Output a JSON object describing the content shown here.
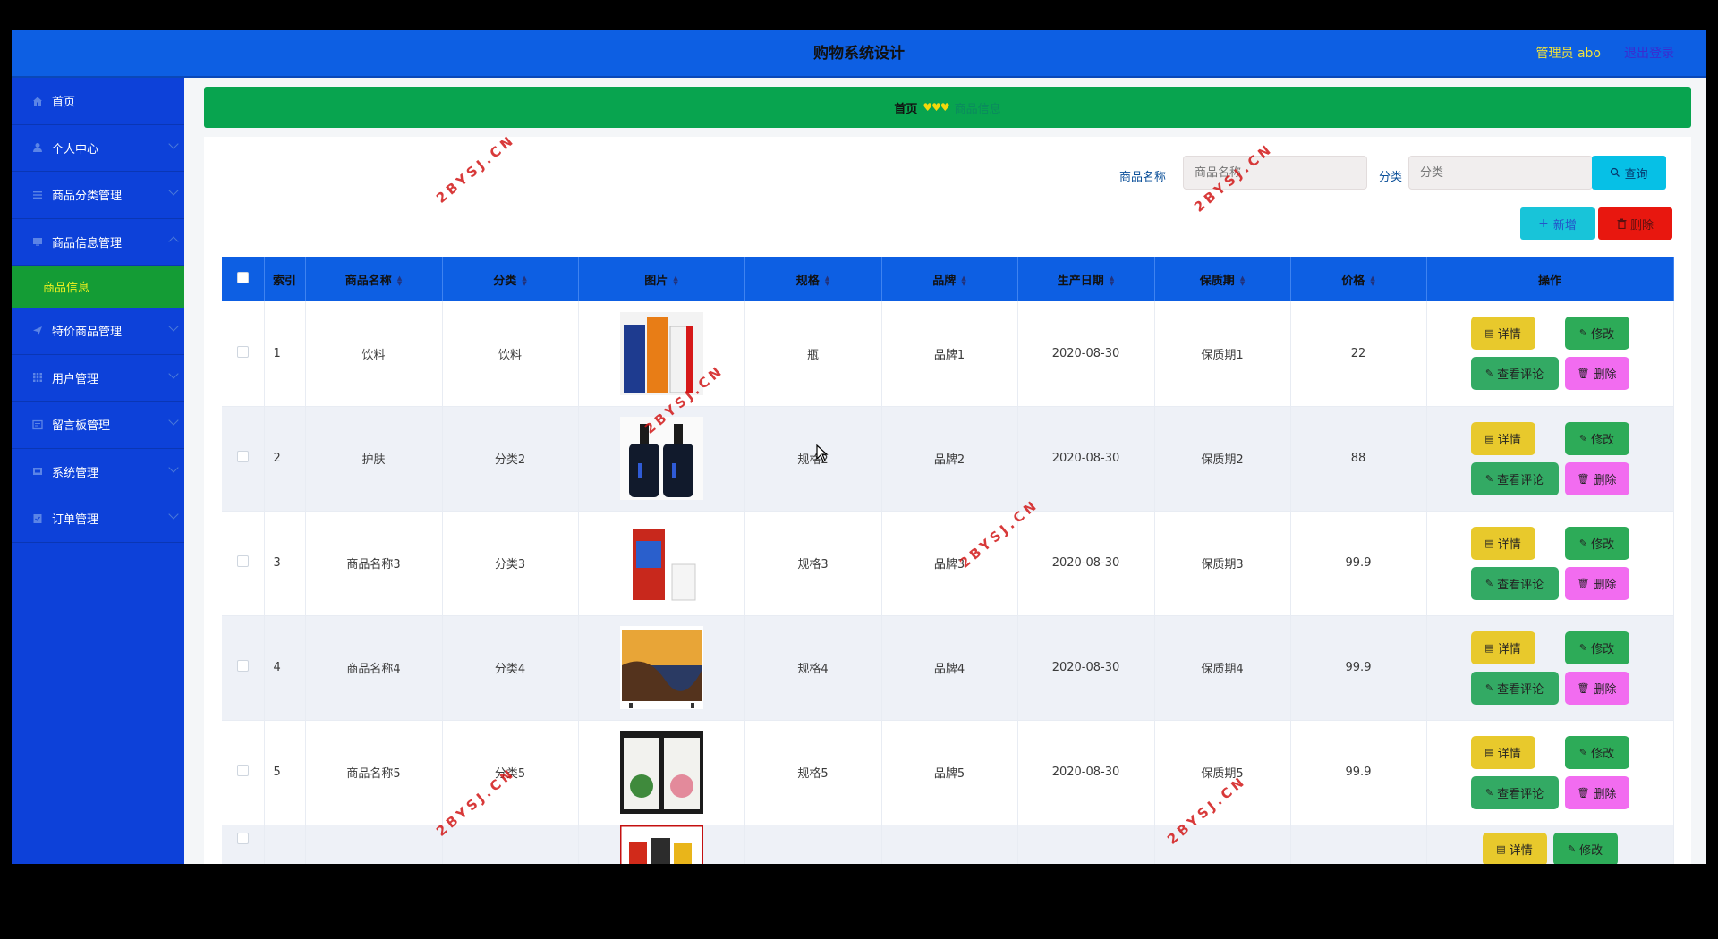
{
  "header": {
    "title": "购物系统设计",
    "admin": "管理员 abo",
    "logout": "退出登录"
  },
  "sidebar": {
    "items": [
      {
        "label": "首页",
        "icon": "home-icon"
      },
      {
        "label": "个人中心",
        "icon": "user-icon"
      },
      {
        "label": "商品分类管理",
        "icon": "list-icon"
      },
      {
        "label": "商品信息管理",
        "icon": "monitor-icon",
        "sub": "商品信息"
      },
      {
        "label": "特价商品管理",
        "icon": "send-icon"
      },
      {
        "label": "用户管理",
        "icon": "grid-icon"
      },
      {
        "label": "留言板管理",
        "icon": "message-icon"
      },
      {
        "label": "系统管理",
        "icon": "settings-icon"
      },
      {
        "label": "订单管理",
        "icon": "order-icon"
      }
    ]
  },
  "breadcrumb": {
    "home": "首页",
    "separator": "♥♥♥",
    "current": "商品信息"
  },
  "search": {
    "name_label": "商品名称",
    "name_placeholder": "商品名称",
    "category_label": "分类",
    "category_placeholder": "分类",
    "query_button": "查询"
  },
  "actions": {
    "add": "新增",
    "delete": "删除"
  },
  "table": {
    "headers": [
      "索引",
      "商品名称",
      "分类",
      "图片",
      "规格",
      "品牌",
      "生产日期",
      "保质期",
      "价格",
      "操作"
    ],
    "rows": [
      {
        "index": "1",
        "name": "饮料",
        "category": "饮料",
        "image": "beverage-cartons-image",
        "spec": "瓶",
        "brand": "品牌1",
        "date": "2020-08-30",
        "shelf": "保质期1",
        "price": "22"
      },
      {
        "index": "2",
        "name": "护肤",
        "category": "分类2",
        "image": "skincare-bottles-image",
        "spec": "规格2",
        "brand": "品牌2",
        "date": "2020-08-30",
        "shelf": "保质期2",
        "price": "88"
      },
      {
        "index": "3",
        "name": "商品名称3",
        "category": "分类3",
        "image": "milk-carton-image",
        "spec": "规格3",
        "brand": "品牌3",
        "date": "2020-08-30",
        "shelf": "保质期3",
        "price": "99.9"
      },
      {
        "index": "4",
        "name": "商品名称4",
        "category": "分类4",
        "image": "television-image",
        "spec": "规格4",
        "brand": "品牌4",
        "date": "2020-08-30",
        "shelf": "保质期4",
        "price": "99.9"
      },
      {
        "index": "5",
        "name": "商品名称5",
        "category": "分类5",
        "image": "cosmetic-boxes-image",
        "spec": "规格5",
        "brand": "品牌5",
        "date": "2020-08-30",
        "shelf": "保质期5",
        "price": "99.9"
      },
      {
        "index": "",
        "name": "",
        "category": "",
        "image": "snack-pack-image",
        "spec": "",
        "brand": "",
        "date": "",
        "shelf": "",
        "price": ""
      }
    ],
    "ops": {
      "detail": "详情",
      "edit": "修改",
      "review": "查看评论",
      "remove": "删除"
    }
  },
  "watermark": "2BYSJ.CN",
  "colors": {
    "header": "#0d5fe3",
    "sidebar": "#0d41d9",
    "breadcrumb": "#08a44f",
    "active_sub": "#149c35"
  }
}
